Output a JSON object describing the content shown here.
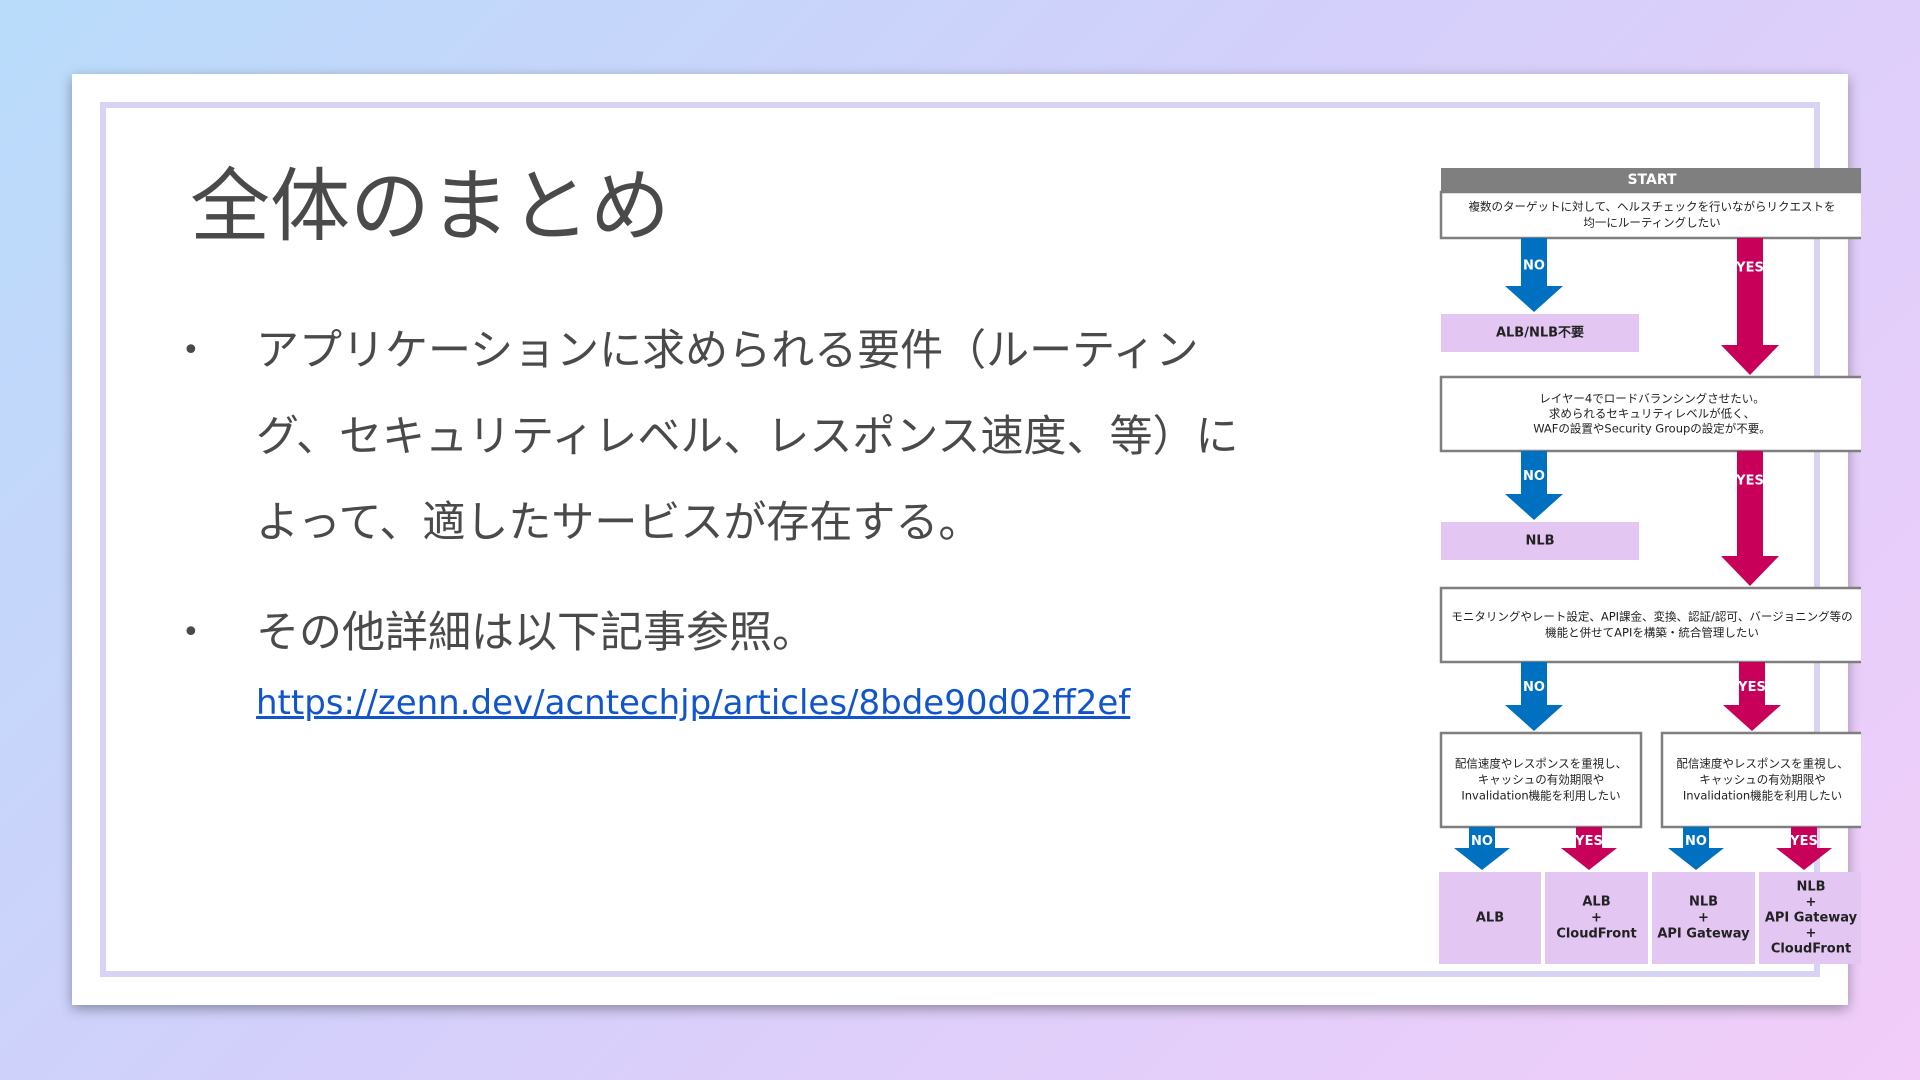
{
  "slide": {
    "title": "全体のまとめ",
    "bullets": [
      {
        "text": "アプリケーションに求められる要件（ルーティング、セキュリティレベル、レスポンス速度、等）によって、適したサービスが存在する。"
      },
      {
        "text": "その他詳細は以下記事参照。",
        "link": "https://zenn.dev/acntechjp/articles/8bde90d02ff2ef"
      }
    ]
  },
  "flowchart": {
    "colors": {
      "no": "#0070c0",
      "yes": "#c8005a",
      "result": "#e4c6f2",
      "header": "#7f7f7f",
      "border": "#7f7f7f"
    },
    "start": "START",
    "no_label": "NO",
    "yes_label": "YES",
    "q1": [
      "複数のターゲットに対して、ヘルスチェックを行いながらリクエストを",
      "均一にルーティングしたい"
    ],
    "r1": "ALB/NLB不要",
    "q2": [
      "レイヤー4でロードバランシングさせたい。",
      "求められるセキュリティレベルが低く、",
      "WAFの設置やSecurity Groupの設定が不要。"
    ],
    "r2": "NLB",
    "q3": [
      "モニタリングやレート設定、API課金、変換、認証/認可、バージョニング等の",
      "機能と併せてAPIを構築・統合管理したい"
    ],
    "q4": [
      "配信速度やレスポンスを重視し、",
      "キャッシュの有効期限や",
      "Invalidation機能を利用したい"
    ],
    "q5": [
      "配信速度やレスポンスを重視し、",
      "キャッシュの有効期限や",
      "Invalidation機能を利用したい"
    ],
    "results": [
      [
        "ALB"
      ],
      [
        "ALB",
        "+",
        "CloudFront"
      ],
      [
        "NLB",
        "+",
        "API Gateway"
      ],
      [
        "NLB",
        "+",
        "API Gateway",
        "+",
        "CloudFront"
      ]
    ]
  }
}
